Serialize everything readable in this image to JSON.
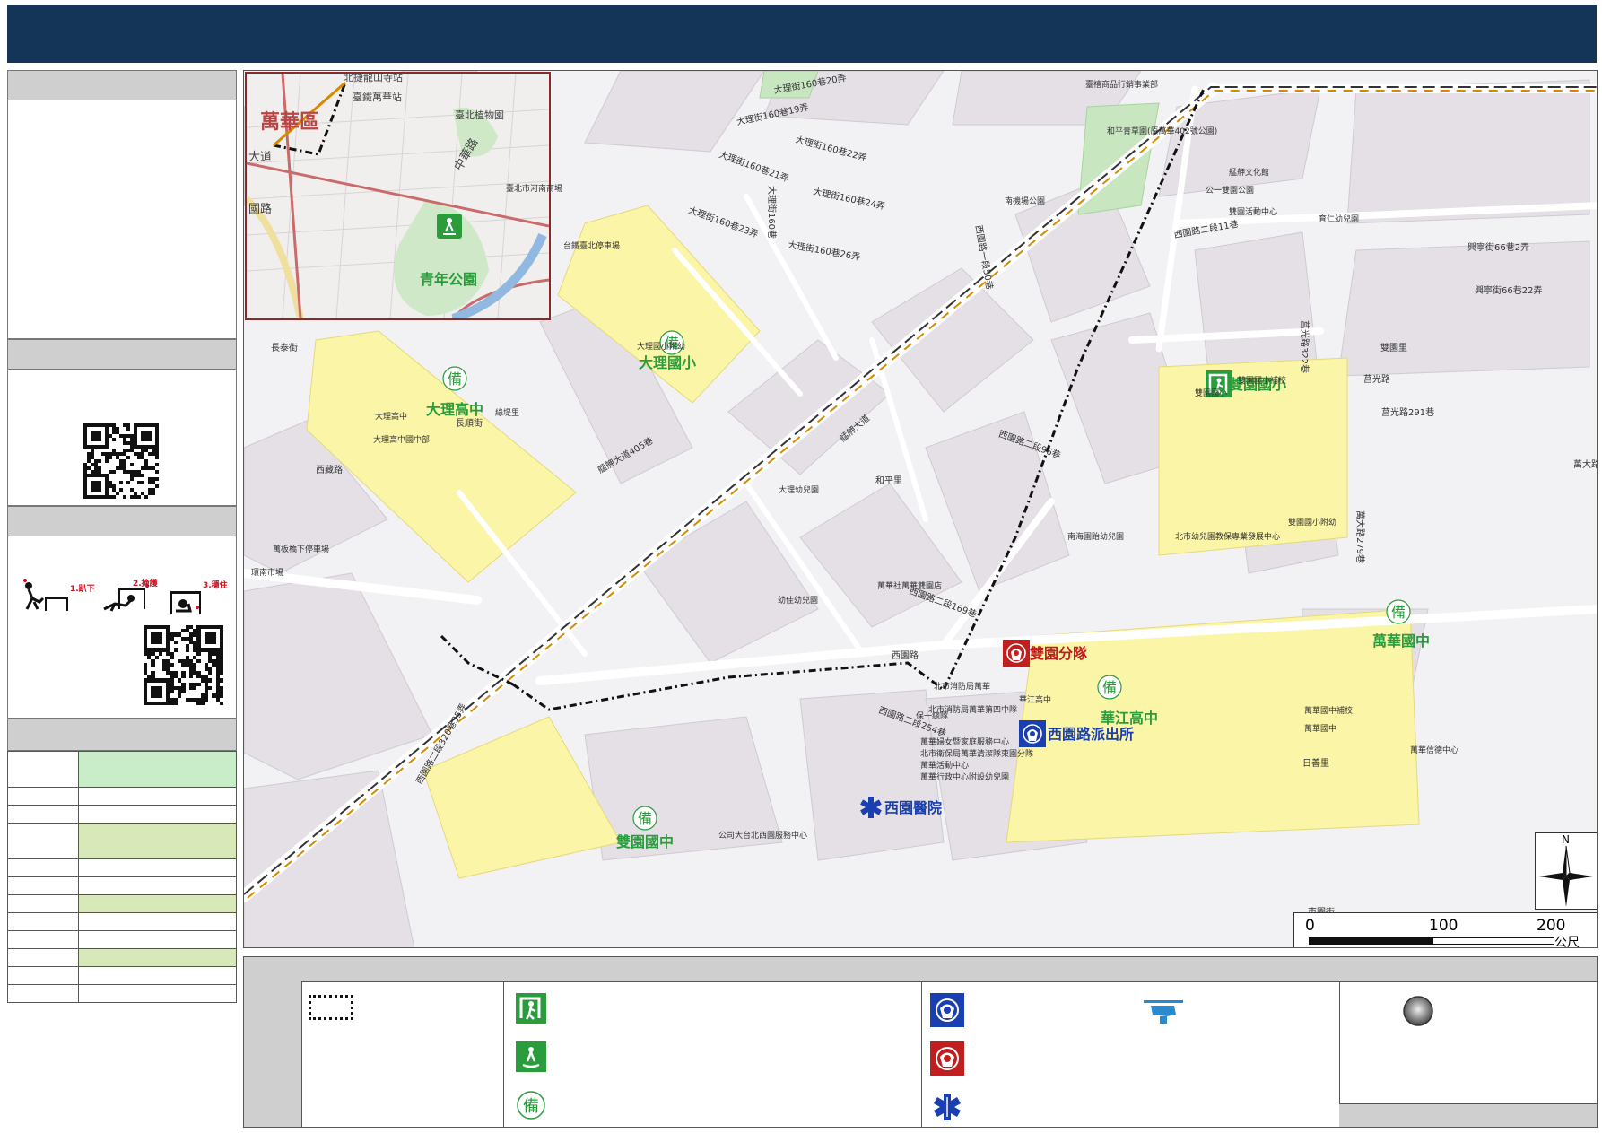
{
  "header": {
    "title": ""
  },
  "left_panel": {
    "qr_codes": [
      "qr-code",
      "qr-code"
    ],
    "drill_steps": [
      "1.趴下",
      "2.掩護",
      "3.穩住"
    ],
    "table_rows": [
      {
        "label": "",
        "value": "",
        "color": "#c9edc9"
      },
      {
        "label": "",
        "value": "",
        "color": "#ffffff"
      },
      {
        "label": "",
        "value": "",
        "color": "#ffffff"
      },
      {
        "label": "",
        "value": "",
        "color": "#d8e8b8"
      },
      {
        "label": "",
        "value": "",
        "color": "#ffffff"
      },
      {
        "label": "",
        "value": "",
        "color": "#ffffff"
      },
      {
        "label": "",
        "value": "",
        "color": "#d8e8b8"
      },
      {
        "label": "",
        "value": "",
        "color": "#ffffff"
      },
      {
        "label": "",
        "value": "",
        "color": "#ffffff"
      },
      {
        "label": "",
        "value": "",
        "color": "#d8e8b8"
      },
      {
        "label": "",
        "value": "",
        "color": "#ffffff"
      },
      {
        "label": "",
        "value": "",
        "color": "#ffffff"
      }
    ]
  },
  "map": {
    "inset": {
      "district": "萬華區",
      "station": "臺鐵萬華站",
      "garden": "臺北植物園",
      "road1": "中華路",
      "road2": "大道",
      "road3": "國路",
      "park": "青年公園",
      "top_road": "北捷龍山寺站"
    },
    "facilities": {
      "dali_high": "大理高中",
      "dali_elem": "大理國小",
      "shuangyuan_elem": "雙園國小",
      "shuangyuan_jr": "雙園國中",
      "wanhua_jr": "萬華國中",
      "huajiang_high": "華江高中",
      "shuangyuan_fire": "雙園分隊",
      "xiyuan_police": "西園路派出所",
      "xiyuan_hospital": "西園醫院",
      "reserve_char": "備"
    },
    "streets": [
      "大理街160巷19弄",
      "大理街160巷20弄",
      "大理街160巷21弄",
      "大理街160巷22弄",
      "大理街160巷23弄",
      "大理街160巷24弄",
      "大理街160巷26弄",
      "大理街160巷",
      "艋舺大道",
      "艋舺大道405巷",
      "西園路一段50巷",
      "西園路二段11巷",
      "西園路二段96巷",
      "莒光路",
      "莒光路322巷",
      "莒光路291巷",
      "西藏路",
      "長泰街",
      "和平里",
      "雙園里",
      "西園路二段169巷",
      "西園路",
      "西園路二段320巷35弄",
      "興寧街66巷22弄",
      "興寧街66巷2弄",
      "萬大路",
      "日善里",
      "東園街",
      "長順街",
      "西園路二段254巷",
      "萬大路279巷"
    ],
    "pois": [
      "臺北市河南商場",
      "台鐵臺北停車場",
      "大理國小附幼",
      "大理高中",
      "大理高中國中部",
      "萬板橋下停車場",
      "環南市場",
      "綠堤里",
      "大理幼兒園",
      "臺禧商品行銷事業部",
      "和平青草園(原萬華402號公園)",
      "南機場公園",
      "艋舺文化館",
      "公一雙園公園",
      "雙園活動中心",
      "育仁幼兒園",
      "雙園國小補校",
      "雙園國小",
      "雙園國小附幼",
      "北市幼兒園教保專業發展中心",
      "南海園跆幼兒園",
      "萬華社萬華雙園店",
      "幼佳幼兒園",
      "北市消防局萬華",
      "北市消防局萬華第四中隊",
      "保一總隊",
      "萬華國中補校",
      "萬華國中",
      "華江高中",
      "萬華婦女暨家庭服務中心",
      "北市衛保局萬華清潔隊東園分隊",
      "萬華活動中心",
      "萬華行政中心附設幼兒園",
      "公司大台北西園服務中心",
      "萬華信德中心"
    ]
  },
  "compass": {
    "north": "N"
  },
  "scale": {
    "ticks": [
      "0",
      "100",
      "200"
    ],
    "unit": "公尺"
  },
  "legend": {
    "columns": [
      "",
      "",
      "",
      "",
      ""
    ],
    "reserve_char": "備"
  }
}
